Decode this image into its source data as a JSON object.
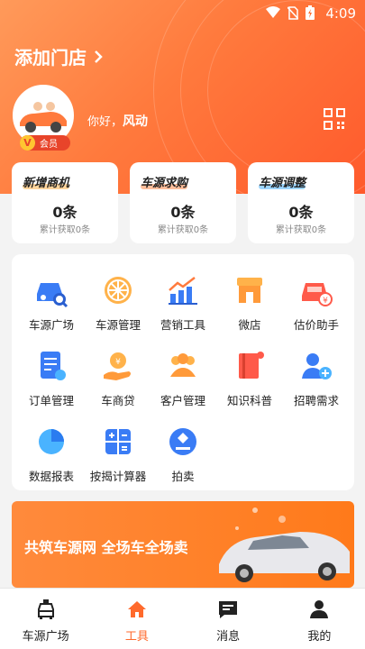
{
  "status_bar": {
    "time": "4:09"
  },
  "header": {
    "store_title": "添加门店",
    "greeting_prefix": "你好，",
    "user_name": "风动",
    "vip_label": "会员",
    "vip_letter": "V"
  },
  "stats": [
    {
      "title": "新增商机",
      "value": "0条",
      "subtitle": "累计获取0条",
      "accent": "#ffb24a"
    },
    {
      "title": "车源求购",
      "value": "0条",
      "subtitle": "累计获取0条",
      "accent": "#ff8a4a"
    },
    {
      "title": "车源调整",
      "value": "0条",
      "subtitle": "累计获取0条",
      "accent": "#4ab3ff"
    }
  ],
  "tools": [
    {
      "label": "车源广场",
      "icon": "car-search-icon"
    },
    {
      "label": "车源管理",
      "icon": "wheel-icon"
    },
    {
      "label": "营销工具",
      "icon": "chart-icon"
    },
    {
      "label": "微店",
      "icon": "shop-icon"
    },
    {
      "label": "估价助手",
      "icon": "car-price-icon"
    },
    {
      "label": "订单管理",
      "icon": "order-icon"
    },
    {
      "label": "车商贷",
      "icon": "loan-icon"
    },
    {
      "label": "客户管理",
      "icon": "customers-icon"
    },
    {
      "label": "知识科普",
      "icon": "book-icon"
    },
    {
      "label": "招聘需求",
      "icon": "add-person-icon"
    },
    {
      "label": "数据报表",
      "icon": "pie-chart-icon"
    },
    {
      "label": "按揭计算器",
      "icon": "calculator-icon"
    },
    {
      "label": "拍卖",
      "icon": "auction-icon"
    }
  ],
  "banner": {
    "text": "共筑车源网 全场车全场卖"
  },
  "tabbar": [
    {
      "label": "车源广场",
      "icon": "car-front-icon",
      "active": false
    },
    {
      "label": "工具",
      "icon": "home-icon",
      "active": true
    },
    {
      "label": "消息",
      "icon": "message-icon",
      "active": false
    },
    {
      "label": "我的",
      "icon": "person-icon",
      "active": false
    }
  ],
  "colors": {
    "brand": "#ff6a2c",
    "tool_blue": "#3a7cf5",
    "tool_orange": "#ff9a3a",
    "tool_red": "#ff5a4a"
  }
}
